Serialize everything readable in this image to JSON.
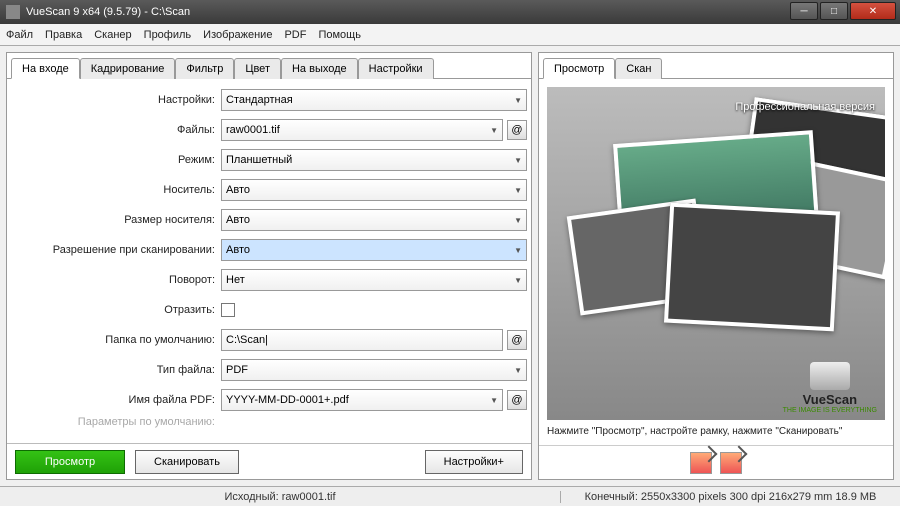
{
  "window": {
    "title": "VueScan 9 x64 (9.5.79) - C:\\Scan"
  },
  "menu": {
    "file": "Файл",
    "edit": "Правка",
    "scanner": "Сканер",
    "profile": "Профиль",
    "image": "Изображение",
    "pdf": "PDF",
    "help": "Помощь"
  },
  "left_tabs": {
    "input": "На входе",
    "crop": "Кадрирование",
    "filter": "Фильтр",
    "color": "Цвет",
    "output": "На выходе",
    "prefs": "Настройки"
  },
  "right_tabs": {
    "preview": "Просмотр",
    "scan": "Скан"
  },
  "labels": {
    "settings": "Настройки:",
    "files": "Файлы:",
    "mode": "Режим:",
    "media": "Носитель:",
    "mediasize": "Размер носителя:",
    "res": "Разрешение при сканировании:",
    "rotate": "Поворот:",
    "mirror": "Отразить:",
    "folder": "Папка по умолчанию:",
    "filetype": "Тип файла:",
    "pdfname": "Имя файла PDF:",
    "defaults": "Параметры по умолчанию:"
  },
  "values": {
    "settings": "Стандартная",
    "files": "raw0001.tif",
    "mode": "Планшетный",
    "media": "Авто",
    "mediasize": "Авто",
    "res": "Авто",
    "rotate": "Нет",
    "folder": "C:\\Scan|",
    "filetype": "PDF",
    "pdfname": "YYYY-MM-DD-0001+.pdf"
  },
  "buttons": {
    "preview": "Просмотр",
    "scan": "Сканировать",
    "settings": "Настройки+"
  },
  "preview": {
    "prof": "Профессиональная версия",
    "hint": "Нажмите \"Просмотр\", настройте рамку, нажмите \"Сканировать\"",
    "brand": "VueScan",
    "tag": "THE IMAGE IS EVERYTHING"
  },
  "status": {
    "left": "Исходный: raw0001.tif",
    "right": "Конечный: 2550x3300 pixels 300 dpi 216x279 mm 18.9 MB"
  },
  "at": "@"
}
